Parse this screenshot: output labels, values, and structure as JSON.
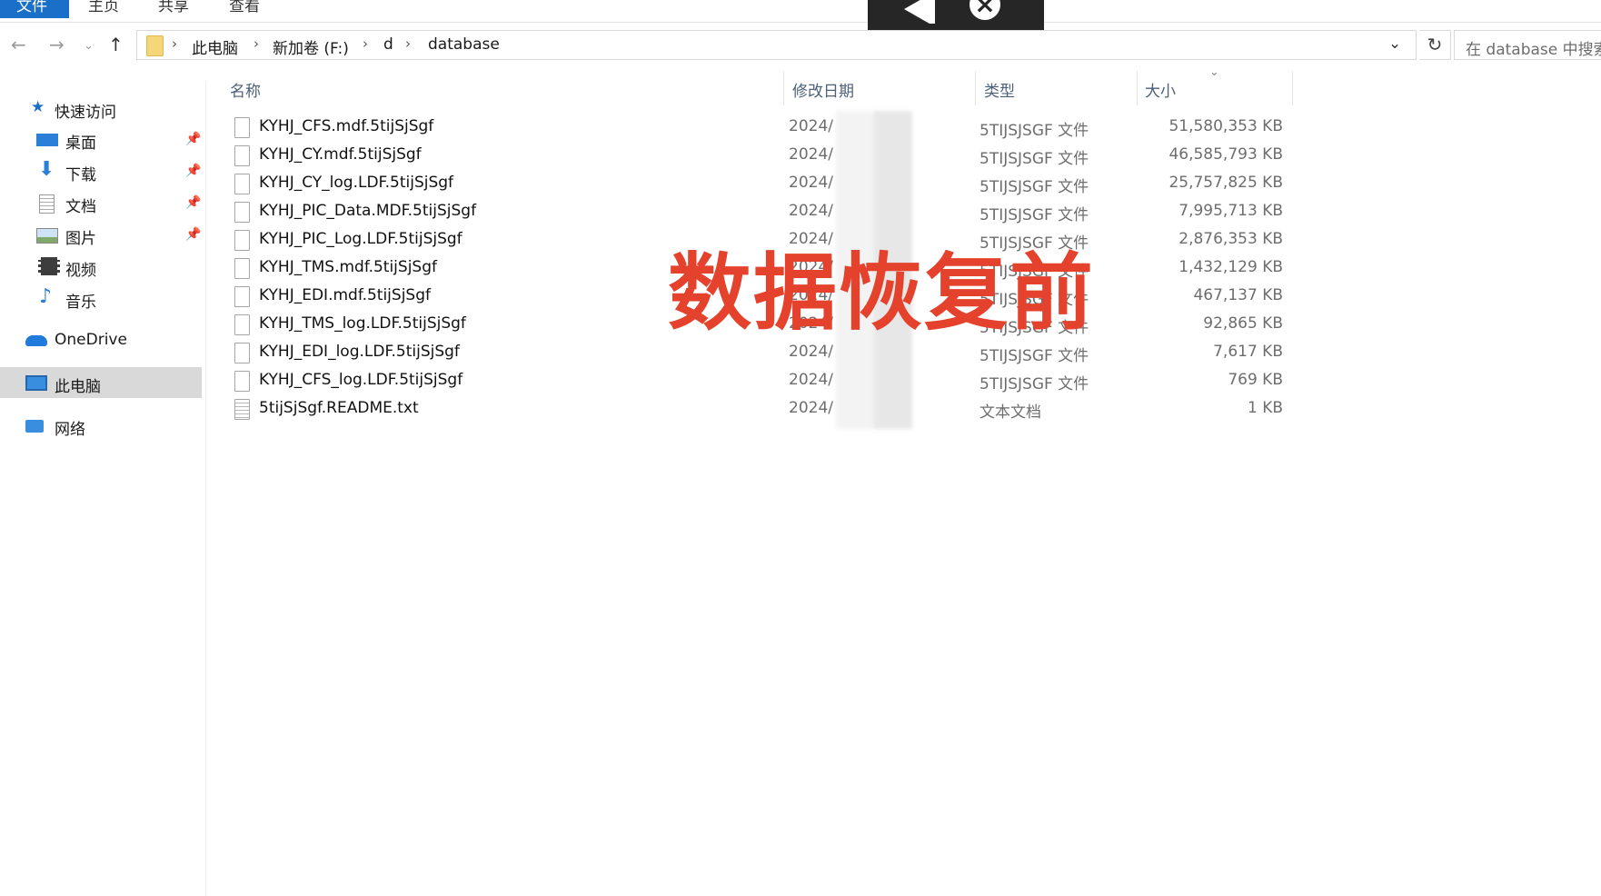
{
  "ribbon": {
    "tabs": [
      "文件",
      "主页",
      "共享",
      "查看"
    ]
  },
  "address": {
    "crumbs": [
      "此电脑",
      "新加卷 (F:)",
      "d",
      "database"
    ]
  },
  "search": {
    "placeholder": "在 database 中搜索"
  },
  "sidebar": {
    "quick_access": "快速访问",
    "items": [
      {
        "label": "桌面",
        "icon": "desktop-icon",
        "pinned": true
      },
      {
        "label": "下载",
        "icon": "download-icon",
        "pinned": true
      },
      {
        "label": "文档",
        "icon": "document-icon",
        "pinned": true
      },
      {
        "label": "图片",
        "icon": "picture-icon",
        "pinned": true
      },
      {
        "label": "视频",
        "icon": "video-icon",
        "pinned": false
      },
      {
        "label": "音乐",
        "icon": "music-icon",
        "pinned": false
      }
    ],
    "onedrive": "OneDrive",
    "this_pc": "此电脑",
    "network": "网络"
  },
  "columns": {
    "name": "名称",
    "date": "修改日期",
    "type": "类型",
    "size": "大小"
  },
  "files": [
    {
      "name": "KYHJ_CFS.mdf.5tijSjSgf",
      "date": "2024/",
      "type": "5TIJSJSGF 文件",
      "size": "51,580,353 KB"
    },
    {
      "name": "KYHJ_CY.mdf.5tijSjSgf",
      "date": "2024/",
      "type": "5TIJSJSGF 文件",
      "size": "46,585,793 KB"
    },
    {
      "name": "KYHJ_CY_log.LDF.5tijSjSgf",
      "date": "2024/",
      "type": "5TIJSJSGF 文件",
      "size": "25,757,825 KB"
    },
    {
      "name": "KYHJ_PIC_Data.MDF.5tijSjSgf",
      "date": "2024/",
      "type": "5TIJSJSGF 文件",
      "size": "7,995,713 KB"
    },
    {
      "name": "KYHJ_PIC_Log.LDF.5tijSjSgf",
      "date": "2024/",
      "type": "5TIJSJSGF 文件",
      "size": "2,876,353 KB"
    },
    {
      "name": "KYHJ_TMS.mdf.5tijSjSgf",
      "date": "2024/",
      "type": "5TIJSJSGF 文件",
      "size": "1,432,129 KB"
    },
    {
      "name": "KYHJ_EDI.mdf.5tijSjSgf",
      "date": "2024/",
      "type": "5TIJSJSGF 文件",
      "size": "467,137 KB"
    },
    {
      "name": "KYHJ_TMS_log.LDF.5tijSjSgf",
      "date": "2024/",
      "type": "5TIJSJSGF 文件",
      "size": "92,865 KB"
    },
    {
      "name": "KYHJ_EDI_log.LDF.5tijSjSgf",
      "date": "2024/",
      "type": "5TIJSJSGF 文件",
      "size": "7,617 KB"
    },
    {
      "name": "KYHJ_CFS_log.LDF.5tijSjSgf",
      "date": "2024/",
      "type": "5TIJSJSGF 文件",
      "size": "769 KB"
    },
    {
      "name": "5tijSjSgf.README.txt",
      "date": "2024/",
      "type": "文本文档",
      "size": "1 KB"
    }
  ],
  "banner": "数据恢复前",
  "colors": {
    "accent": "#1a6fc9",
    "banner": "#e4422d"
  }
}
